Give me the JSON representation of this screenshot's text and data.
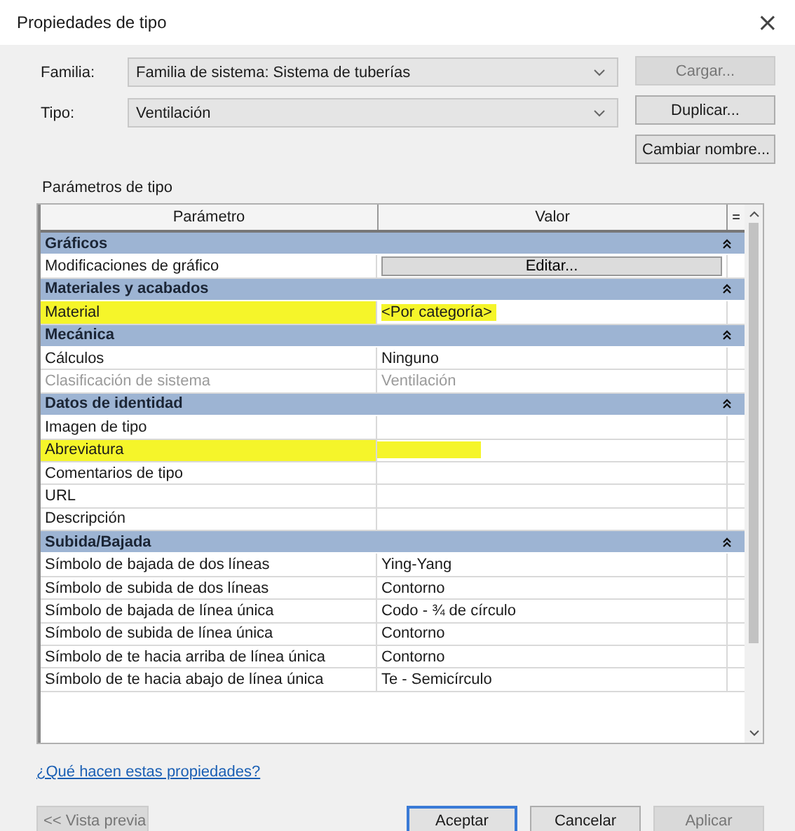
{
  "window": {
    "title": "Propiedades de tipo",
    "close": "×"
  },
  "family": {
    "label": "Familia:",
    "value": "Familia de sistema: Sistema de tuberías"
  },
  "type": {
    "label": "Tipo:",
    "value": "Ventilación"
  },
  "side_buttons": [
    {
      "label": "Cargar...",
      "disabled": true
    },
    {
      "label": "Duplicar...",
      "disabled": false
    },
    {
      "label": "Cambiar nombre...",
      "disabled": false
    }
  ],
  "section_label": "Parámetros de tipo",
  "table": {
    "columns": [
      "Parámetro",
      "Valor"
    ],
    "sort_button": "=",
    "rows": [
      {
        "kind": "group",
        "name": "Gráficos"
      },
      {
        "kind": "button",
        "name": "Modificaciones de gráfico",
        "value": "Editar..."
      },
      {
        "kind": "group",
        "name": "Materiales y acabados"
      },
      {
        "kind": "param",
        "name": "Material",
        "value": "<Por categoría>",
        "highlighted": true,
        "disabled": false
      },
      {
        "kind": "group",
        "name": "Mecánica"
      },
      {
        "kind": "param",
        "name": "Cálculos",
        "value": "Ninguno",
        "highlighted": false,
        "disabled": false
      },
      {
        "kind": "param",
        "name": "Clasificación de sistema",
        "value": "Ventilación",
        "highlighted": false,
        "disabled": true
      },
      {
        "kind": "group",
        "name": "Datos de identidad"
      },
      {
        "kind": "param",
        "name": "Imagen de tipo",
        "highlighted": false,
        "disabled": false
      },
      {
        "kind": "param",
        "name": "Abreviatura",
        "highlighted": true,
        "disabled": false
      },
      {
        "kind": "param",
        "name": "Comentarios de tipo",
        "highlighted": false,
        "disabled": false
      },
      {
        "kind": "param",
        "name": "URL",
        "highlighted": false,
        "disabled": false
      },
      {
        "kind": "param",
        "name": "Descripción",
        "highlighted": false,
        "disabled": false
      },
      {
        "kind": "group",
        "name": "Subida/Bajada"
      },
      {
        "kind": "param",
        "name": "Símbolo de bajada de dos líneas",
        "value": "Ying-Yang",
        "highlighted": false,
        "disabled": false
      },
      {
        "kind": "param",
        "name": "Símbolo de subida de dos líneas",
        "value": "Contorno",
        "highlighted": false,
        "disabled": false
      },
      {
        "kind": "param",
        "name": "Símbolo de bajada de línea única",
        "value": "Codo - ¾ de círculo",
        "highlighted": false,
        "disabled": false
      },
      {
        "kind": "param",
        "name": "Símbolo de subida de línea única",
        "value": "Contorno",
        "highlighted": false,
        "disabled": false
      },
      {
        "kind": "param",
        "name": "Símbolo de te hacia arriba de línea única",
        "value": "Contorno",
        "highlighted": false,
        "disabled": false
      },
      {
        "kind": "param",
        "name": "Símbolo de te hacia abajo de línea única",
        "value": "Te - Semicírculo",
        "highlighted": false,
        "disabled": false
      }
    ]
  },
  "help_link": "¿Qué hacen estas propiedades?",
  "preview_button": {
    "label": "<< Vista previa",
    "disabled": true
  },
  "buttons": [
    {
      "label": "Aceptar",
      "default": true,
      "disabled": false
    },
    {
      "label": "Cancelar",
      "default": false,
      "disabled": false
    },
    {
      "label": "Aplicar",
      "default": false,
      "disabled": true
    }
  ]
}
